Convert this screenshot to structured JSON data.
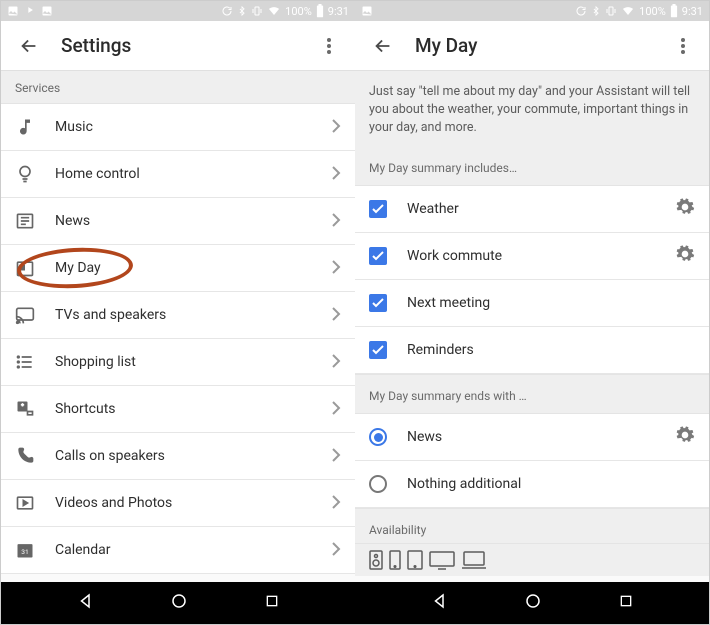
{
  "status": {
    "battery": "100%",
    "time": "9:31"
  },
  "left": {
    "title": "Settings",
    "section": "Services",
    "items": [
      {
        "label": "Music",
        "icon": "music"
      },
      {
        "label": "Home control",
        "icon": "bulb"
      },
      {
        "label": "News",
        "icon": "news"
      },
      {
        "label": "My Day",
        "icon": "today"
      },
      {
        "label": "TVs and speakers",
        "icon": "cast"
      },
      {
        "label": "Shopping list",
        "icon": "list"
      },
      {
        "label": "Shortcuts",
        "icon": "shortcut"
      },
      {
        "label": "Calls on speakers",
        "icon": "phone"
      },
      {
        "label": "Videos and Photos",
        "icon": "video"
      },
      {
        "label": "Calendar",
        "icon": "calendar"
      }
    ]
  },
  "right": {
    "title": "My Day",
    "intro": "Just say \"tell me about my day\" and your Assistant will tell you about the weather, your commute, important things in your day, and more.",
    "includes_header": "My Day summary includes…",
    "includes": [
      {
        "label": "Weather",
        "checked": true,
        "gear": true
      },
      {
        "label": "Work commute",
        "checked": true,
        "gear": true
      },
      {
        "label": "Next meeting",
        "checked": true,
        "gear": false
      },
      {
        "label": "Reminders",
        "checked": true,
        "gear": false
      }
    ],
    "ends_header": "My Day summary ends with …",
    "ends": [
      {
        "label": "News",
        "selected": true,
        "gear": true
      },
      {
        "label": "Nothing additional",
        "selected": false,
        "gear": false
      }
    ],
    "availability_header": "Availability"
  }
}
